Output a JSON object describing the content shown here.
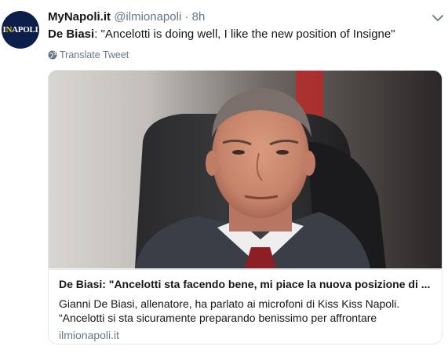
{
  "avatar": {
    "text_main": "NAPOLI",
    "text_accent": "i",
    "text_prefix": "I",
    "text_dot": "."
  },
  "header": {
    "name_bold": "My",
    "name_rest": "Napoli.it",
    "handle": "@ilmionapoli",
    "separator": "·",
    "time": "8h"
  },
  "tweet": {
    "speaker": "De Biasi",
    "text": ": \"Ancelotti is doing well, I like the new position of Insigne\""
  },
  "translate": {
    "label": "Translate Tweet",
    "icon": "globe-icon"
  },
  "card": {
    "title": "De Biasi: \"Ancelotti sta facendo bene, mi piace la nuova posizione di ...",
    "description_line1": "Gianni De Biasi, allenatore, ha parlato ai microfoni di Kiss Kiss Napoli.",
    "description_line2": "“Ancelotti si sta sicuramente preparando benissimo per affrontare",
    "domain": "ilmionapoli.it"
  },
  "colors": {
    "muted": "#657786",
    "border": "#e1e8ed",
    "avatar_bg": "#0b1f4a"
  }
}
